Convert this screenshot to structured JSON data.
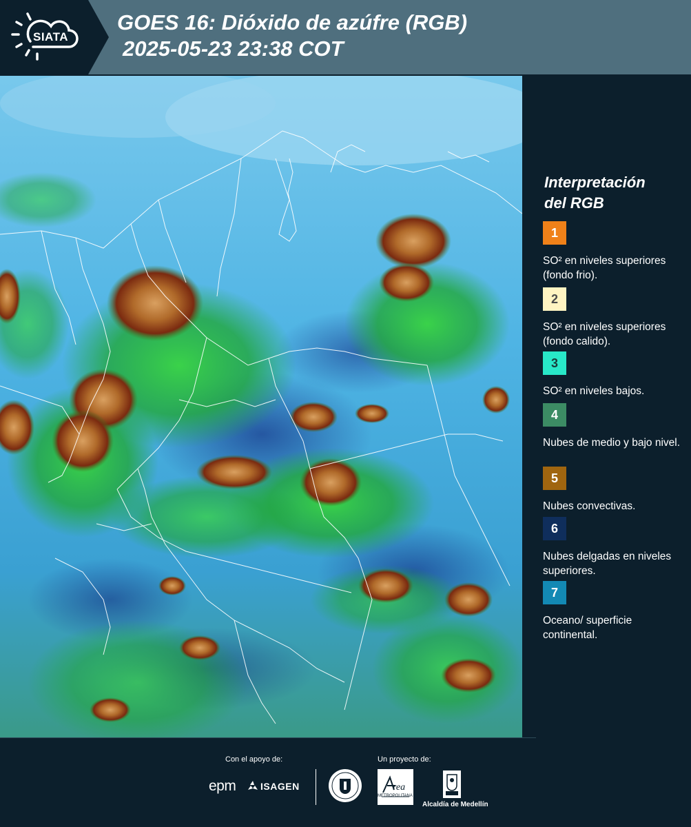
{
  "header": {
    "logo_text": "SIATA",
    "title_line1": "GOES 16: Dióxido de azúfre (RGB)",
    "title_line2": "2025-05-23 23:38 COT"
  },
  "legend": {
    "title_line1": "Interpretación",
    "title_line2": "del RGB",
    "items": [
      {
        "number": "1",
        "color": "#f08119",
        "text_color": "#ffffff",
        "label": "SO² en niveles superiores (fondo frio)."
      },
      {
        "number": "2",
        "color": "#fff4c2",
        "text_color": "#4a4a4a",
        "label": "SO² en niveles superiores (fondo calido)."
      },
      {
        "number": "3",
        "color": "#28e8c8",
        "text_color": "#1a3a3a",
        "label": "SO² en niveles bajos."
      },
      {
        "number": "4",
        "color": "#3c8c64",
        "text_color": "#ffffff",
        "label": "Nubes de medio y bajo nivel."
      },
      {
        "number": "5",
        "color": "#a0650f",
        "text_color": "#ffffff",
        "label": "Nubes convectivas."
      },
      {
        "number": "6",
        "color": "#0f2e5c",
        "text_color": "#ffffff",
        "label": "Nubes delgadas en niveles superiores."
      },
      {
        "number": "7",
        "color": "#1389b4",
        "text_color": "#ffffff",
        "label": "Oceano/ superficie continental."
      }
    ]
  },
  "footer": {
    "support_label": "Con el apoyo de:",
    "project_label": "Un proyecto de:",
    "epm_label": "epm",
    "isagen_label": "ISAGEN",
    "area_label": "Área",
    "area_sub_label": "METROPOLITANA",
    "alcaldia_label": "Alcaldía de Medellín"
  }
}
